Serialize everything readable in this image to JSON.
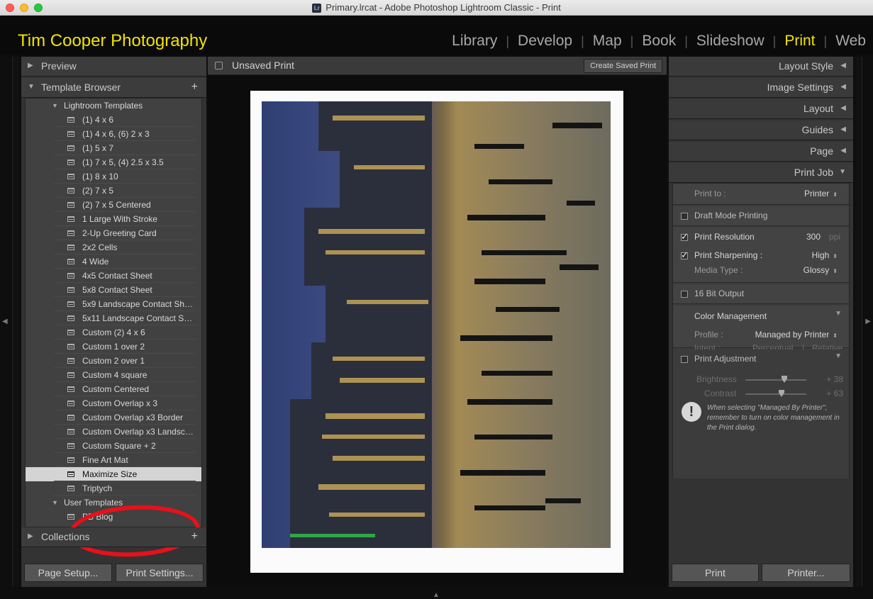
{
  "window": {
    "title": "Primary.lrcat - Adobe Photoshop Lightroom Classic - Print",
    "badge": "Lr"
  },
  "identity_plate": "Tim Cooper Photography",
  "modules": [
    {
      "label": "Library"
    },
    {
      "label": "Develop"
    },
    {
      "label": "Map"
    },
    {
      "label": "Book"
    },
    {
      "label": "Slideshow"
    },
    {
      "label": "Print"
    },
    {
      "label": "Web"
    }
  ],
  "active_module": "Print",
  "left_panel": {
    "preview": "Preview",
    "template_browser": "Template Browser",
    "lightroom_templates_folder": "Lightroom Templates",
    "lightroom_templates": [
      "(1) 4 x 6",
      "(1) 4 x 6, (6) 2 x 3",
      "(1) 5 x 7",
      "(1) 7 x 5, (4) 2.5 x 3.5",
      "(1) 8 x 10",
      "(2) 7 x 5",
      "(2) 7 x 5 Centered",
      "1 Large With Stroke",
      "2-Up Greeting Card",
      "2x2 Cells",
      "4 Wide",
      "4x5 Contact Sheet",
      "5x8 Contact Sheet",
      "5x9 Landscape Contact Sh…",
      "5x11 Landscape Contact S…",
      "Custom (2) 4 x 6",
      "Custom 1 over 2",
      "Custom 2 over 1",
      "Custom 4 square",
      "Custom Centered",
      "Custom Overlap x 3",
      "Custom Overlap x3 Border",
      "Custom Overlap x3 Landsc…",
      "Custom Square + 2",
      "Fine Art Mat",
      "Maximize Size",
      "Triptych"
    ],
    "selected_template": "Maximize Size",
    "user_templates_folder": "User Templates",
    "user_templates": [
      "PB Blog"
    ],
    "collections": "Collections",
    "page_setup_button": "Page Setup...",
    "print_settings_button": "Print Settings..."
  },
  "center": {
    "title": "Unsaved Print",
    "create_saved_print": "Create Saved Print"
  },
  "right_panel": {
    "sections": [
      "Layout Style",
      "Image Settings",
      "Layout",
      "Guides",
      "Page"
    ],
    "print_job": "Print Job",
    "print_to_label": "Print to :",
    "print_to_value": "Printer",
    "draft_mode": "Draft Mode Printing",
    "print_resolution": "Print Resolution",
    "resolution_value": "300",
    "resolution_unit": "ppi",
    "print_sharpening": "Print Sharpening :",
    "sharpening_value": "High",
    "media_type_label": "Media Type :",
    "media_type_value": "Glossy",
    "bit_output": "16 Bit Output",
    "color_management": "Color Management",
    "profile_label": "Profile :",
    "profile_value": "Managed by Printer",
    "intent_label": "Intent :",
    "intent_perceptual": "Perceptual",
    "intent_relative": "Relative",
    "print_adjustment": "Print Adjustment",
    "brightness_label": "Brightness",
    "brightness_value": "+ 38",
    "contrast_label": "Contrast",
    "contrast_value": "+ 63",
    "warning_note": "When selecting \"Managed By Printer\", remember to turn on color management in the Print dialog.",
    "print_button": "Print",
    "printer_button": "Printer..."
  }
}
